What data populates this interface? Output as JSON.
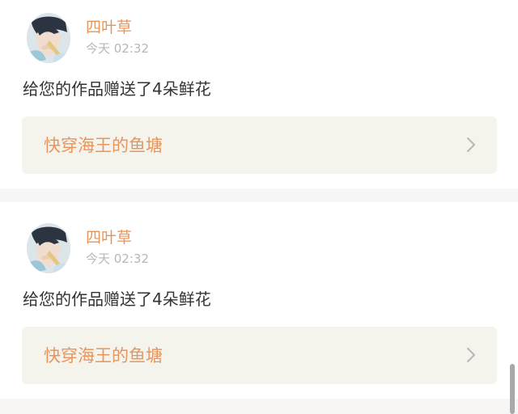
{
  "notifications": [
    {
      "username": "四叶草",
      "time": "今天 02:32",
      "message": "给您的作品赠送了4朵鲜花",
      "work_title": "快穿海王的鱼塘",
      "chevron_icon": "chevron-right-icon"
    },
    {
      "username": "四叶草",
      "time": "今天 02:32",
      "message": "给您的作品赠送了4朵鲜花",
      "work_title": "快穿海王的鱼塘",
      "chevron_icon": "chevron-right-icon"
    }
  ],
  "colors": {
    "accent": "#e8945b",
    "timestamp": "#b7b7b7",
    "message": "#333333",
    "link_background": "#f5f4ec",
    "feed_background": "#f7f6f4"
  }
}
